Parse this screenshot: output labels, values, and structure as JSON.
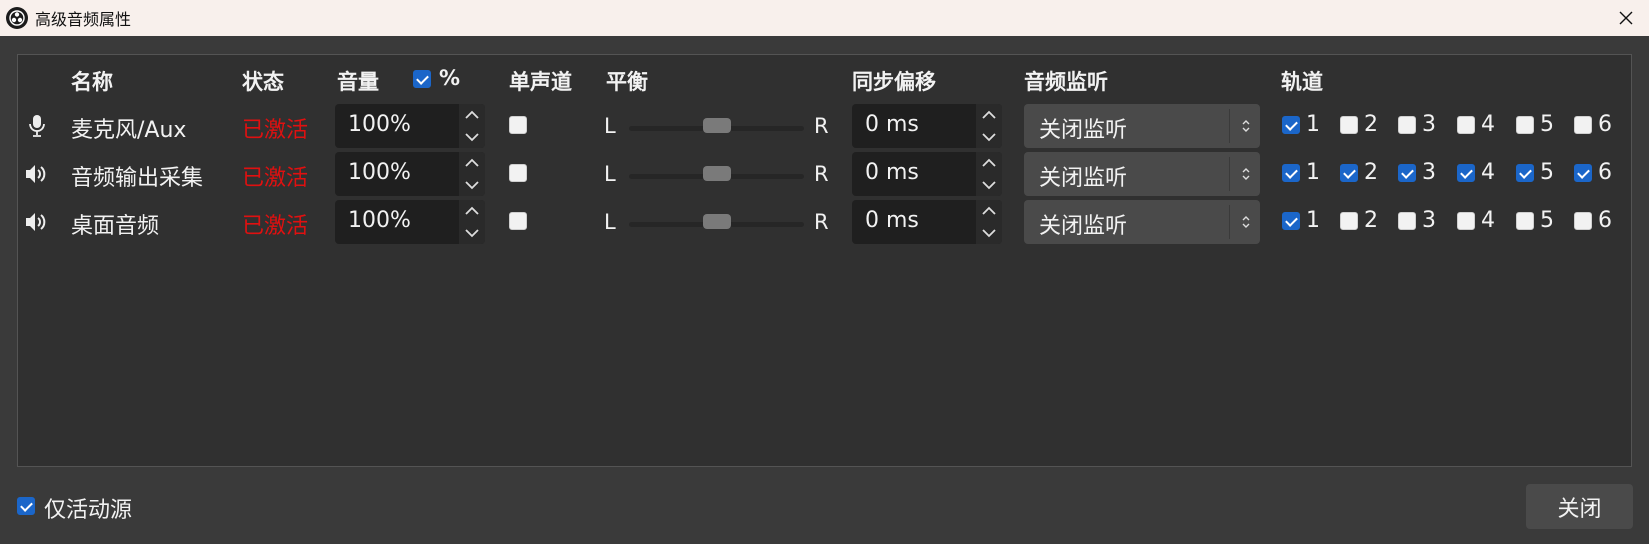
{
  "window": {
    "title": "高级音频属性",
    "close_icon": "close-icon"
  },
  "headers": {
    "name": "名称",
    "status": "状态",
    "volume": "音量",
    "percent_label": "%",
    "percent_checked": true,
    "mono": "单声道",
    "balance": "平衡",
    "sync_offset": "同步偏移",
    "monitoring": "音频监听",
    "tracks": "轨道"
  },
  "rows": [
    {
      "icon": "microphone-icon",
      "name": "麦克风/Aux",
      "status": "已激活",
      "volume": "100%",
      "mono": false,
      "balance_left": "L",
      "balance_right": "R",
      "balance": 0.5,
      "sync_offset": "0 ms",
      "monitoring": "关闭监听",
      "tracks": [
        {
          "label": "1",
          "checked": true
        },
        {
          "label": "2",
          "checked": false
        },
        {
          "label": "3",
          "checked": false
        },
        {
          "label": "4",
          "checked": false
        },
        {
          "label": "5",
          "checked": false
        },
        {
          "label": "6",
          "checked": false
        }
      ]
    },
    {
      "icon": "speaker-icon",
      "name": "音频输出采集",
      "status": "已激活",
      "volume": "100%",
      "mono": false,
      "balance_left": "L",
      "balance_right": "R",
      "balance": 0.5,
      "sync_offset": "0 ms",
      "monitoring": "关闭监听",
      "tracks": [
        {
          "label": "1",
          "checked": true
        },
        {
          "label": "2",
          "checked": true
        },
        {
          "label": "3",
          "checked": true
        },
        {
          "label": "4",
          "checked": true
        },
        {
          "label": "5",
          "checked": true
        },
        {
          "label": "6",
          "checked": true
        }
      ]
    },
    {
      "icon": "speaker-icon",
      "name": "桌面音频",
      "status": "已激活",
      "volume": "100%",
      "mono": false,
      "balance_left": "L",
      "balance_right": "R",
      "balance": 0.5,
      "sync_offset": "0 ms",
      "monitoring": "关闭监听",
      "tracks": [
        {
          "label": "1",
          "checked": true
        },
        {
          "label": "2",
          "checked": false
        },
        {
          "label": "3",
          "checked": false
        },
        {
          "label": "4",
          "checked": false
        },
        {
          "label": "5",
          "checked": false
        },
        {
          "label": "6",
          "checked": false
        }
      ]
    }
  ],
  "footer": {
    "active_only_label": "仅活动源",
    "active_only_checked": true,
    "close_button": "关闭"
  },
  "colors": {
    "status_active": "#e01010",
    "checkbox_on": "#1b66c9",
    "background": "#3a3a3a"
  }
}
